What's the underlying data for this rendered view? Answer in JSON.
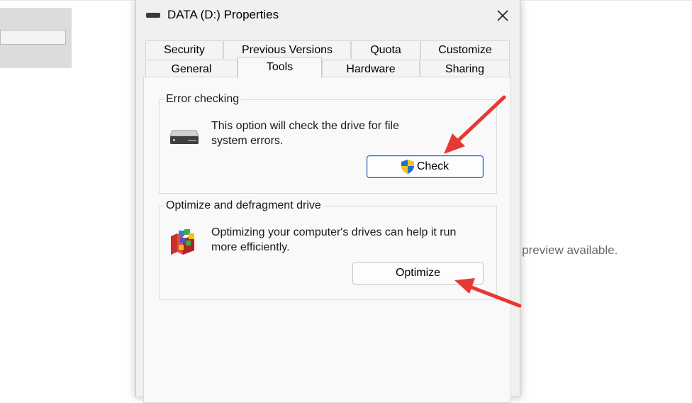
{
  "background": {
    "preview_text": "o preview available."
  },
  "dialog": {
    "title": "DATA (D:) Properties",
    "close_icon": "close-icon",
    "tabs_row1": [
      {
        "label": "Security"
      },
      {
        "label": "Previous Versions"
      },
      {
        "label": "Quota"
      },
      {
        "label": "Customize"
      }
    ],
    "tabs_row2": [
      {
        "label": "General"
      },
      {
        "label": "Tools",
        "active": true
      },
      {
        "label": "Hardware"
      },
      {
        "label": "Sharing"
      }
    ]
  },
  "error_checking": {
    "legend": "Error checking",
    "description": "This option will check the drive for file system errors.",
    "button_label": "Check",
    "icon": "hard-drive-icon",
    "button_icon": "uac-shield-icon"
  },
  "optimize": {
    "legend": "Optimize and defragment drive",
    "description": "Optimizing your computer's drives can help it run more efficiently.",
    "button_label": "Optimize",
    "icon": "defragment-icon"
  },
  "annotations": {
    "arrow_color": "#e53935"
  }
}
